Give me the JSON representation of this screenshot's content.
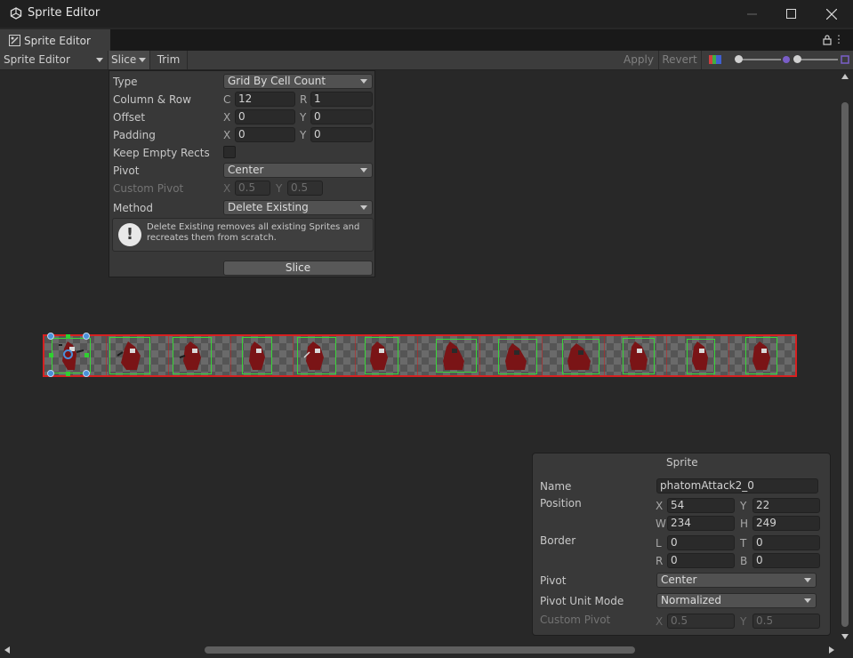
{
  "window": {
    "title": "Sprite Editor"
  },
  "tab": {
    "label": "Sprite Editor"
  },
  "toolbar": {
    "mode_dropdown": "Sprite Editor",
    "slice_label": "Slice",
    "trim_label": "Trim",
    "apply_label": "Apply",
    "revert_label": "Revert"
  },
  "slice_panel": {
    "type_label": "Type",
    "type_value": "Grid By Cell Count",
    "column_row_label": "Column & Row",
    "c_axis": "C",
    "c_value": "12",
    "r_axis": "R",
    "r_value": "1",
    "offset_label": "Offset",
    "offset_x_axis": "X",
    "offset_x": "0",
    "offset_y_axis": "Y",
    "offset_y": "0",
    "padding_label": "Padding",
    "padding_x_axis": "X",
    "padding_x": "0",
    "padding_y_axis": "Y",
    "padding_y": "0",
    "keep_empty_label": "Keep Empty Rects",
    "keep_empty_checked": false,
    "pivot_label": "Pivot",
    "pivot_value": "Center",
    "custom_pivot_label": "Custom Pivot",
    "custom_pivot_x_axis": "X",
    "custom_pivot_x": "0.5",
    "custom_pivot_y_axis": "Y",
    "custom_pivot_y": "0.5",
    "method_label": "Method",
    "method_value": "Delete Existing",
    "help_icon": "exclamation-icon",
    "help_text": "Delete Existing removes all existing Sprites and recreates them from scratch.",
    "slice_button": "Slice"
  },
  "sprite_strip": {
    "frame_count": 12,
    "selected_index": 0
  },
  "sprite_panel": {
    "header": "Sprite",
    "name_label": "Name",
    "name_value": "phatomAttack2_0",
    "position_label": "Position",
    "x_axis": "X",
    "x_value": "54",
    "y_axis": "Y",
    "y_value": "22",
    "w_axis": "W",
    "w_value": "234",
    "h_axis": "H",
    "h_value": "249",
    "border_label": "Border",
    "l_axis": "L",
    "l_value": "0",
    "t_axis": "T",
    "t_value": "0",
    "r_axis": "R",
    "r_value": "0",
    "b_axis": "B",
    "b_value": "0",
    "pivot_label": "Pivot",
    "pivot_value": "Center",
    "pivot_unit_label": "Pivot Unit Mode",
    "pivot_unit_value": "Normalized",
    "custom_pivot_label": "Custom Pivot",
    "custom_pivot_x_axis": "X",
    "custom_pivot_x": "0.5",
    "custom_pivot_y_axis": "Y",
    "custom_pivot_y": "0.5"
  },
  "colors": {
    "slice_outline": "#d62020",
    "sprite_rect": "#39d639",
    "handle": "#4a90d9"
  }
}
